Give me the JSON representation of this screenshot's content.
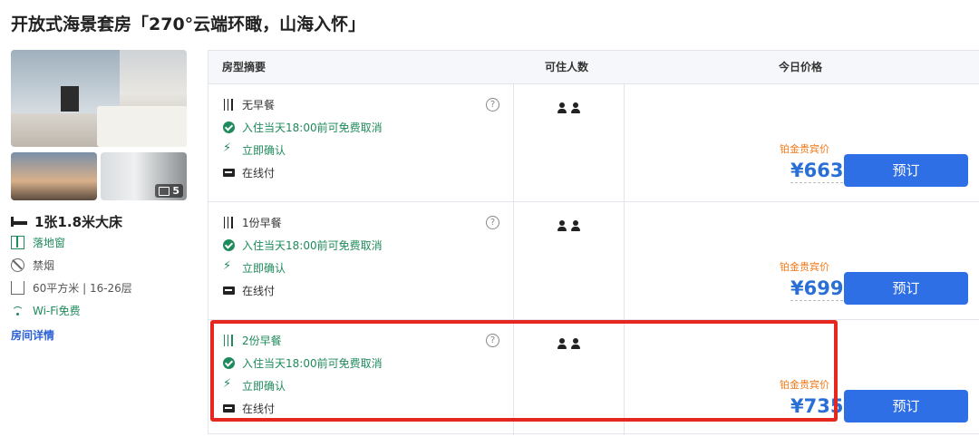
{
  "page_title": "开放式海景套房「270°云端环瞰，山海入怀」",
  "room": {
    "photo_count": "5",
    "bed_type": "1张1.8米大床",
    "features": [
      {
        "icon": "window-icon",
        "label": "落地窗",
        "color": "#1f8a5b"
      },
      {
        "icon": "no-smoking-icon",
        "label": "禁烟",
        "color": "#555555"
      },
      {
        "icon": "area-icon",
        "label": "60平方米 | 16-26层",
        "color": "#555555"
      },
      {
        "icon": "wifi-icon",
        "label": "Wi-Fi免费",
        "color": "#1f8a5b"
      }
    ],
    "detail_link": "房间详情"
  },
  "table": {
    "headers": {
      "summary": "房型摘要",
      "occupancy": "可住人数",
      "price": "今日价格"
    },
    "rows": [
      {
        "meal": "无早餐",
        "cancel": "入住当天18:00前可免费取消",
        "confirm": "立即确认",
        "payment": "在线付",
        "occupancy": 2,
        "badge": "铂金贵宾价",
        "price": "¥663",
        "book_label": "预订"
      },
      {
        "meal": "1份早餐",
        "cancel": "入住当天18:00前可免费取消",
        "confirm": "立即确认",
        "payment": "在线付",
        "occupancy": 2,
        "badge": "铂金贵宾价",
        "price": "¥699",
        "book_label": "预订"
      },
      {
        "meal": "2份早餐",
        "cancel": "入住当天18:00前可免费取消",
        "confirm": "立即确认",
        "payment": "在线付",
        "occupancy": 2,
        "badge": "铂金贵宾价",
        "price": "¥735",
        "book_label": "预订"
      }
    ]
  },
  "colors": {
    "accent_blue": "#2f6fe6",
    "price_blue": "#2a6fd6",
    "green": "#1f8a5b",
    "badge_orange": "#f07a1a",
    "highlight_red": "#e5271f"
  }
}
